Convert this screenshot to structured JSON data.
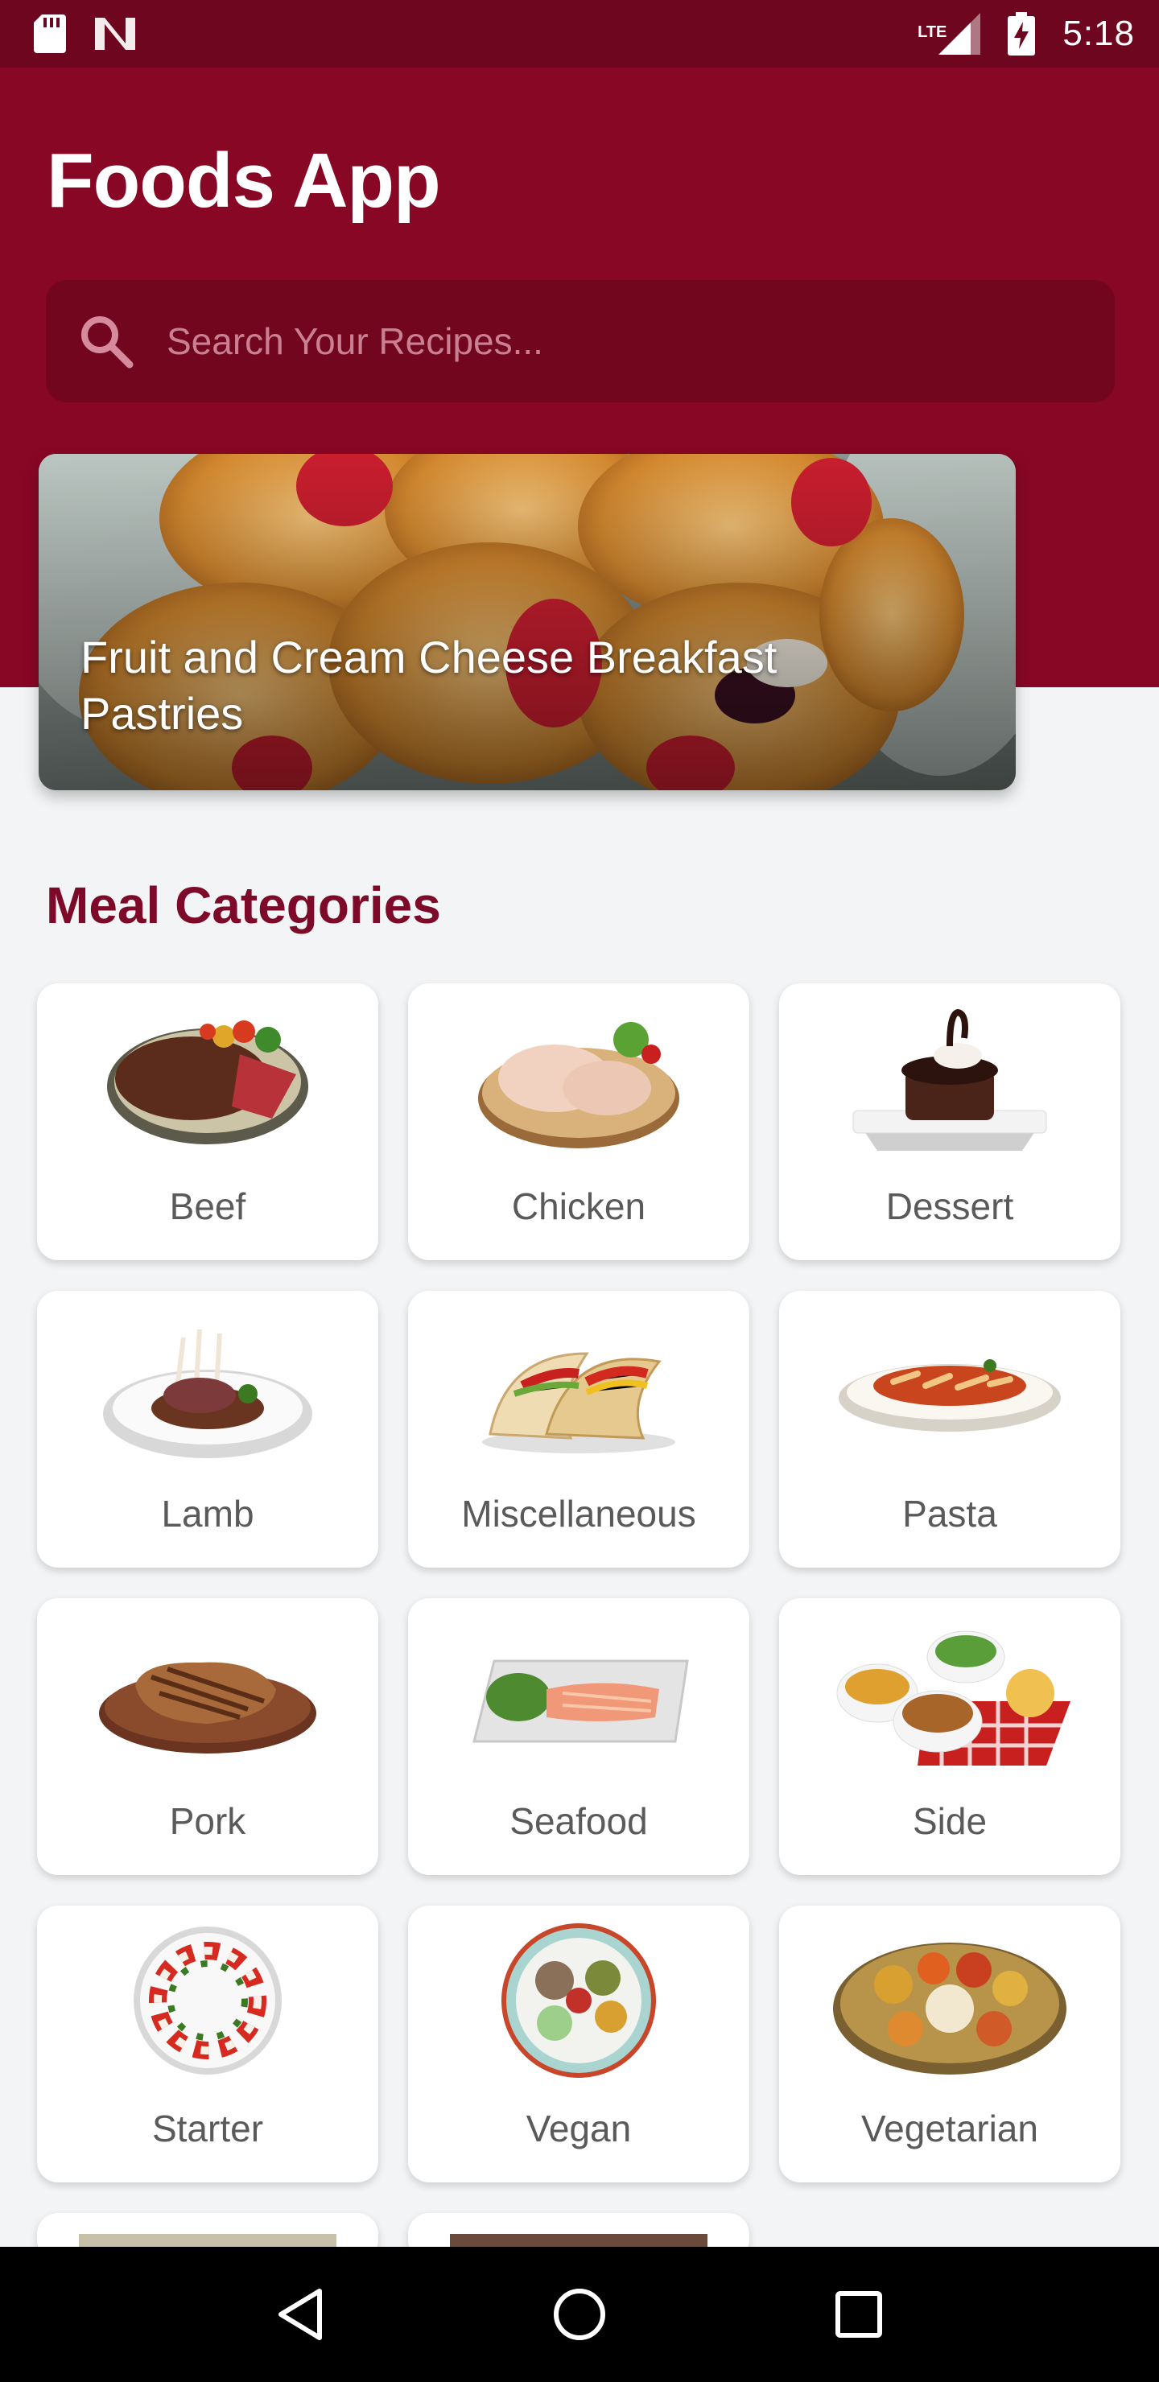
{
  "status_bar": {
    "time": "5:18",
    "network": "LTE",
    "left_icons": [
      "sd-card-icon",
      "n-notification-icon"
    ],
    "right_icons": [
      "lte-signal-icon",
      "battery-charging-icon"
    ]
  },
  "header": {
    "title": "Foods App",
    "bg_color": "#880725",
    "status_color": "#6e0620"
  },
  "search": {
    "placeholder": "Search Your Recipes..."
  },
  "featured": {
    "title": "Fruit and Cream Cheese Breakfast Pastries"
  },
  "categories_section": {
    "title": "Meal Categories",
    "accent_color": "#7d0a28",
    "items": [
      {
        "label": "Beef",
        "icon": "beef-icon"
      },
      {
        "label": "Chicken",
        "icon": "chicken-icon"
      },
      {
        "label": "Dessert",
        "icon": "dessert-icon"
      },
      {
        "label": "Lamb",
        "icon": "lamb-icon"
      },
      {
        "label": "Miscellaneous",
        "icon": "miscellaneous-icon"
      },
      {
        "label": "Pasta",
        "icon": "pasta-icon"
      },
      {
        "label": "Pork",
        "icon": "pork-icon"
      },
      {
        "label": "Seafood",
        "icon": "seafood-icon"
      },
      {
        "label": "Side",
        "icon": "side-icon"
      },
      {
        "label": "Starter",
        "icon": "starter-icon"
      },
      {
        "label": "Vegan",
        "icon": "vegan-icon"
      },
      {
        "label": "Vegetarian",
        "icon": "vegetarian-icon"
      }
    ]
  },
  "nav_bar": {
    "buttons": [
      "back-icon",
      "home-icon",
      "recents-icon"
    ]
  }
}
